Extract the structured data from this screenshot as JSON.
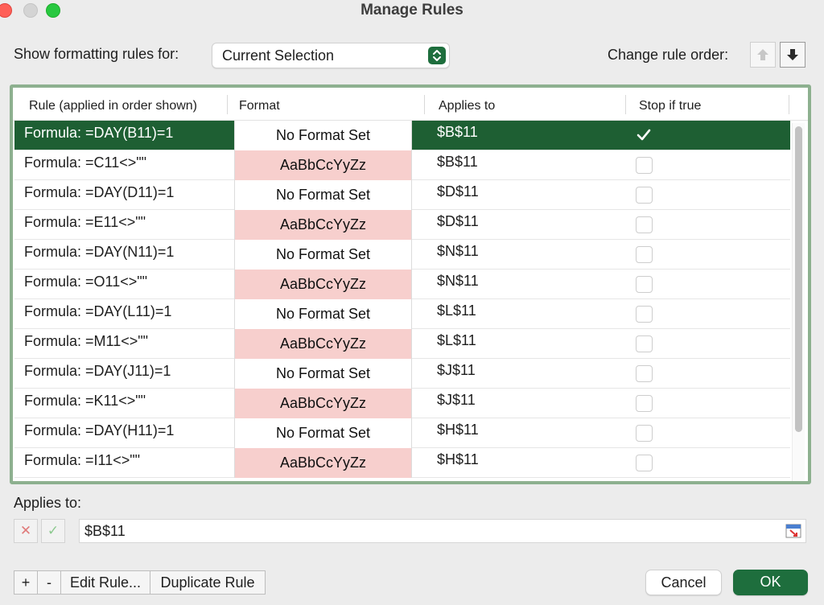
{
  "window": {
    "title": "Manage Rules"
  },
  "header": {
    "show_label": "Show formatting rules for:",
    "selection_value": "Current Selection",
    "order_label": "Change rule order:"
  },
  "table": {
    "columns": [
      "Rule (applied in order shown)",
      "Format",
      "Applies to",
      "Stop if true"
    ],
    "rows": [
      {
        "rule": "Formula: =DAY(B11)=1",
        "format": "No Format Set",
        "format_type": "none",
        "applies": "$B$11",
        "stop": true,
        "selected": true
      },
      {
        "rule": "Formula: =C11<>\"\"",
        "format": "AaBbCcYyZz",
        "format_type": "fill",
        "applies": "$B$11",
        "stop": false,
        "selected": false
      },
      {
        "rule": "Formula: =DAY(D11)=1",
        "format": "No Format Set",
        "format_type": "none",
        "applies": "$D$11",
        "stop": false,
        "selected": false
      },
      {
        "rule": "Formula: =E11<>\"\"",
        "format": "AaBbCcYyZz",
        "format_type": "fill",
        "applies": "$D$11",
        "stop": false,
        "selected": false
      },
      {
        "rule": "Formula: =DAY(N11)=1",
        "format": "No Format Set",
        "format_type": "none",
        "applies": "$N$11",
        "stop": false,
        "selected": false
      },
      {
        "rule": "Formula: =O11<>\"\"",
        "format": "AaBbCcYyZz",
        "format_type": "fill",
        "applies": "$N$11",
        "stop": false,
        "selected": false
      },
      {
        "rule": "Formula: =DAY(L11)=1",
        "format": "No Format Set",
        "format_type": "none",
        "applies": "$L$11",
        "stop": false,
        "selected": false
      },
      {
        "rule": "Formula: =M11<>\"\"",
        "format": "AaBbCcYyZz",
        "format_type": "fill",
        "applies": "$L$11",
        "stop": false,
        "selected": false
      },
      {
        "rule": "Formula: =DAY(J11)=1",
        "format": "No Format Set",
        "format_type": "none",
        "applies": "$J$11",
        "stop": false,
        "selected": false
      },
      {
        "rule": "Formula: =K11<>\"\"",
        "format": "AaBbCcYyZz",
        "format_type": "fill",
        "applies": "$J$11",
        "stop": false,
        "selected": false
      },
      {
        "rule": "Formula: =DAY(H11)=1",
        "format": "No Format Set",
        "format_type": "none",
        "applies": "$H$11",
        "stop": false,
        "selected": false
      },
      {
        "rule": "Formula: =I11<>\"\"",
        "format": "AaBbCcYyZz",
        "format_type": "fill",
        "applies": "$H$11",
        "stop": false,
        "selected": false
      }
    ]
  },
  "applies_to": {
    "label": "Applies to:",
    "cancel_glyph": "✕",
    "accept_glyph": "✓",
    "value": "$B$11"
  },
  "footer": {
    "add_label": "+",
    "remove_label": "-",
    "edit_label": "Edit Rule...",
    "duplicate_label": "Duplicate Rule",
    "cancel_label": "Cancel",
    "ok_label": "OK"
  },
  "colors": {
    "accent": "#1e6e3d",
    "selected_row": "#1e5f33",
    "format_fill": "#f7cfcd",
    "frame": "#8db08f"
  },
  "icons": [
    "close-window-icon",
    "minimize-window-icon",
    "zoom-window-icon",
    "up-down-arrows-icon",
    "arrow-up-icon",
    "arrow-down-icon",
    "checkmark-icon",
    "collapse-dialog-icon"
  ]
}
